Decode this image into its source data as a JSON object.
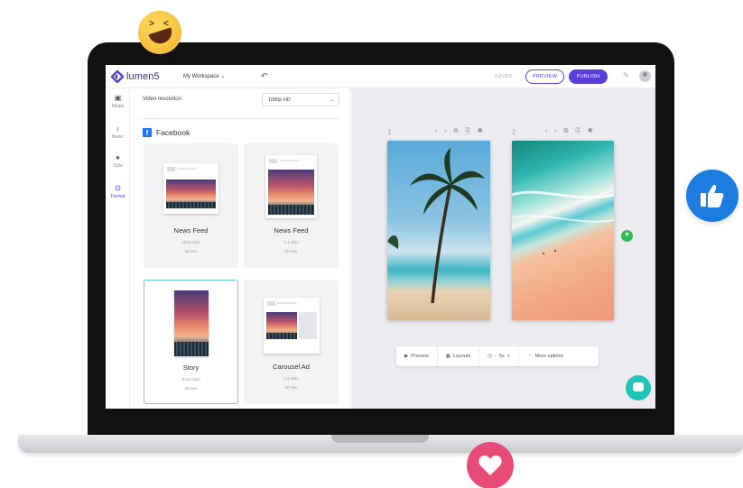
{
  "app": {
    "logo_text": "lumen5",
    "workspace_label": "My Workspace ⌄",
    "undo_icon": "↶",
    "saved_label": "SAVED",
    "preview_label": "PREVIEW",
    "publish_label": "PUBLISH",
    "brand_color": "#5b3fd9"
  },
  "rail": {
    "items": [
      {
        "label": "Media",
        "icon": "▣"
      },
      {
        "label": "Music",
        "icon": "♪"
      },
      {
        "label": "Style",
        "icon": "♠"
      },
      {
        "label": "Format",
        "icon": "⊡"
      }
    ]
  },
  "panel": {
    "resolution_label": "Video resolution",
    "resolution_value": "1080p HD",
    "section_title": "Facebook",
    "formats": [
      {
        "title": "News Feed",
        "ratio": "16:9 ratio",
        "duration": "40 sec"
      },
      {
        "title": "News Feed",
        "ratio": "1:1 ratio",
        "duration": "60 sec"
      },
      {
        "title": "Story",
        "ratio": "9:16 ratio",
        "duration": "20 sec"
      },
      {
        "title": "Carousel Ad",
        "ratio": "1:1 ratio",
        "duration": "30 sec"
      }
    ]
  },
  "canvas": {
    "slide1_num": "1",
    "slide2_num": "2",
    "slide_tools": "‹ › ⧉ ⎘ ◉",
    "add_icon": "+",
    "toolbar": {
      "preview": "Preview",
      "layouts": "Layouts",
      "speed": "5s",
      "more": "More options"
    }
  }
}
